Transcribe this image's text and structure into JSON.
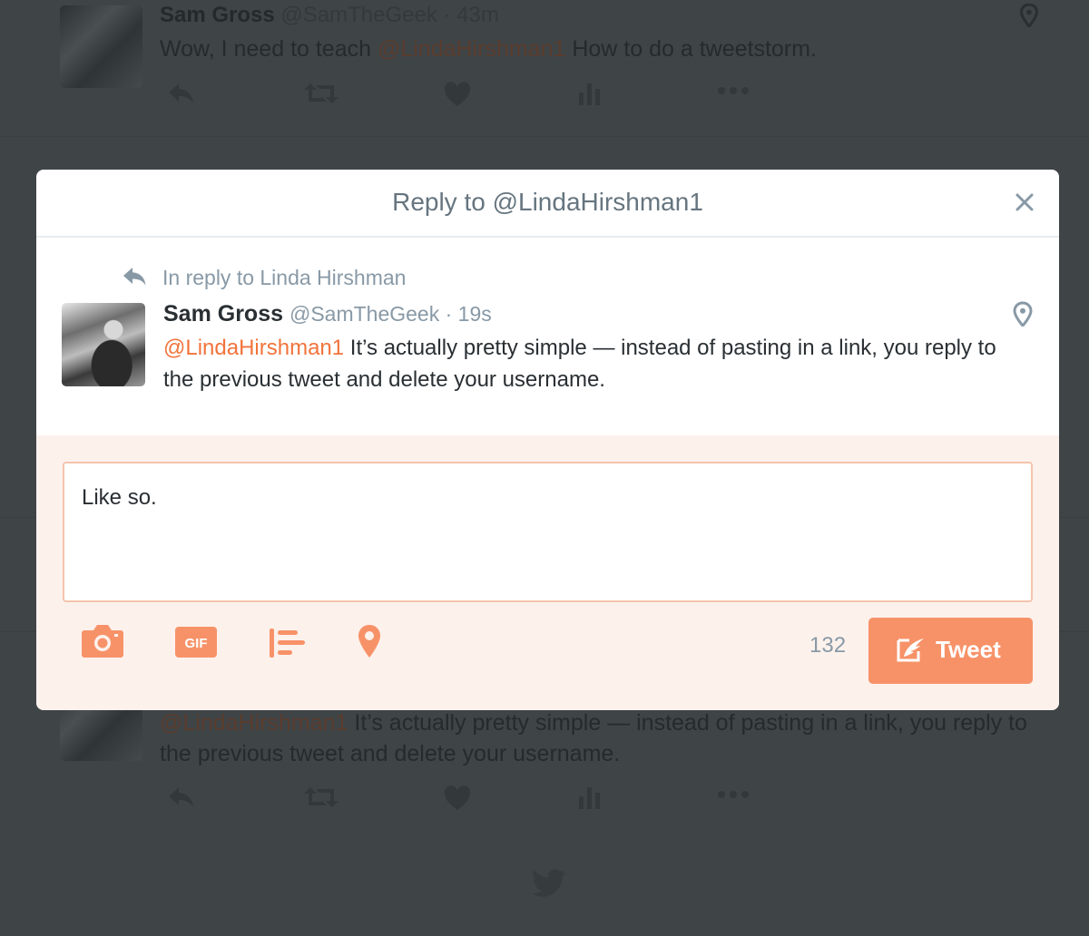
{
  "background": {
    "tweet_top": {
      "name": "Sam Gross",
      "handle": "@SamTheGeek",
      "time": "· 43m",
      "text_before": "Wow, I need to teach ",
      "mention": "@LindaHirshman1",
      "text_after": " How to do a tweetstorm."
    },
    "tweet_bottom": {
      "mention": "@LindaHirshman1",
      "text": " It’s actually pretty simple — instead of pasting in a link, you reply to the previous tweet and delete your username."
    }
  },
  "modal": {
    "title": "Reply to @LindaHirshman1",
    "close_icon": "close-icon",
    "reply_context": "In reply to Linda Hirshman",
    "original": {
      "name": "Sam Gross",
      "handle": "@SamTheGeek",
      "time": "· 19s",
      "mention": "@LindaHirshman1",
      "text": " It’s actually pretty simple — instead of pasting in a link, you reply to the previous tweet and delete your username."
    },
    "compose": {
      "value": "Like so.",
      "char_count": "132",
      "tweet_label": "Tweet",
      "tools": [
        "camera-icon",
        "gif-icon",
        "poll-icon",
        "location-icon"
      ]
    }
  },
  "colors": {
    "accent": "#f79268",
    "mention": "#f2733b",
    "compose_bg": "#fdf1ec",
    "muted": "#8899a6",
    "overlay": "#3f4447"
  }
}
